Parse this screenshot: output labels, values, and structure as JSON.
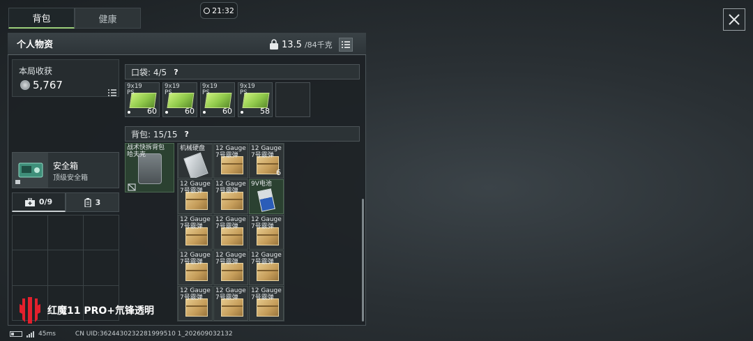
{
  "tabs": [
    {
      "label": "背包",
      "active": true
    },
    {
      "label": "健康",
      "active": false
    }
  ],
  "clock": "21:32",
  "panel": {
    "title": "个人物资",
    "weight_current": "13.5",
    "weight_max": "/84千克"
  },
  "income": {
    "title": "本局收获",
    "value": "5,767"
  },
  "safe": {
    "title": "安全箱",
    "subtitle": "顶级安全箱"
  },
  "subtabs": [
    {
      "label": "0/9",
      "icon": "medkit-icon",
      "active": true
    },
    {
      "label": "3",
      "icon": "magazine-icon",
      "active": false
    }
  ],
  "pocket": {
    "label": "口袋:",
    "capacity": "4/5",
    "help": "?",
    "slots": [
      {
        "name": "9x19\nPS",
        "count": "60"
      },
      {
        "name": "9x19\nPS",
        "count": "60"
      },
      {
        "name": "9x19\nPS",
        "count": "60"
      },
      {
        "name": "9x19\nPS",
        "count": "58"
      },
      {
        "name": "",
        "count": ""
      }
    ]
  },
  "backpack": {
    "label": "背包:",
    "capacity": "15/15",
    "help": "?",
    "equipped": "战术快拆背包\n哈夫克",
    "items": [
      {
        "name": "机械硬盘",
        "type": "hdd",
        "count": ""
      },
      {
        "name": "12 Gauge\n7号霰弹",
        "type": "box",
        "count": ""
      },
      {
        "name": "12 Gauge\n7号霰弹",
        "type": "box",
        "count": "6"
      },
      {
        "name": "12 Gauge\n7号霰弹",
        "type": "box",
        "count": ""
      },
      {
        "name": "12 Gauge\n7号霰弹",
        "type": "box",
        "count": ""
      },
      {
        "name": "9V电池",
        "type": "battery",
        "count": ""
      },
      {
        "name": "12 Gauge\n7号霰弹",
        "type": "box",
        "count": ""
      },
      {
        "name": "12 Gauge\n7号霰弹",
        "type": "box",
        "count": ""
      },
      {
        "name": "12 Gauge\n7号霰弹",
        "type": "box",
        "count": ""
      },
      {
        "name": "12 Gauge\n7号霰弹",
        "type": "box",
        "count": ""
      },
      {
        "name": "12 Gauge\n7号霰弹",
        "type": "box",
        "count": ""
      },
      {
        "name": "12 Gauge\n7号霰弹",
        "type": "box",
        "count": ""
      },
      {
        "name": "12 Gauge\n7号霰弹",
        "type": "box",
        "count": ""
      },
      {
        "name": "12 Gauge\n7号霰弹",
        "type": "box",
        "count": ""
      },
      {
        "name": "12 Gauge\n7号霰弹",
        "type": "box",
        "count": ""
      }
    ]
  },
  "brand": "红魔11 PRO+氘锋透明",
  "status": {
    "ping": "45ms",
    "uid": "CN UID:3624430232281999510 1_202609032132"
  },
  "colors": {
    "accent_green": "#9ccf7b",
    "ammo_green": "#8fc84a",
    "equipped_bg": "#2b4131",
    "brand_red": "#e3202d"
  }
}
